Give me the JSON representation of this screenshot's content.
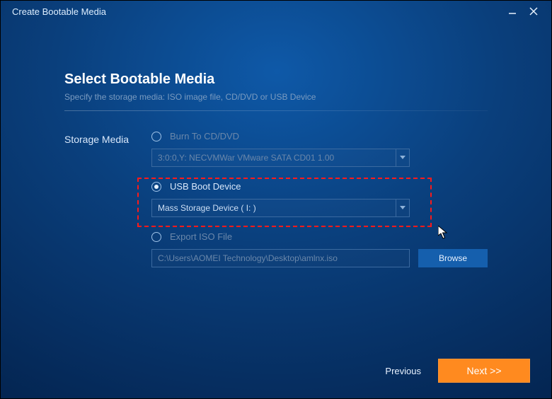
{
  "window": {
    "title": "Create Bootable Media"
  },
  "page": {
    "title": "Select Bootable Media",
    "subtitle": "Specify the storage media: ISO image file, CD/DVD or USB Device"
  },
  "storage_label": "Storage Media",
  "options": {
    "cd": {
      "label": "Burn To CD/DVD",
      "selected_value": "3:0:0,Y: NECVMWar VMware SATA CD01 1.00"
    },
    "usb": {
      "label": "USB Boot Device",
      "selected_value": "Mass    Storage Device  ( I: )"
    },
    "iso": {
      "label": "Export ISO File",
      "path": "C:\\Users\\AOMEI Technology\\Desktop\\amlnx.iso",
      "browse_label": "Browse"
    }
  },
  "footer": {
    "previous": "Previous",
    "next": "Next >>"
  },
  "selected_option": "usb"
}
